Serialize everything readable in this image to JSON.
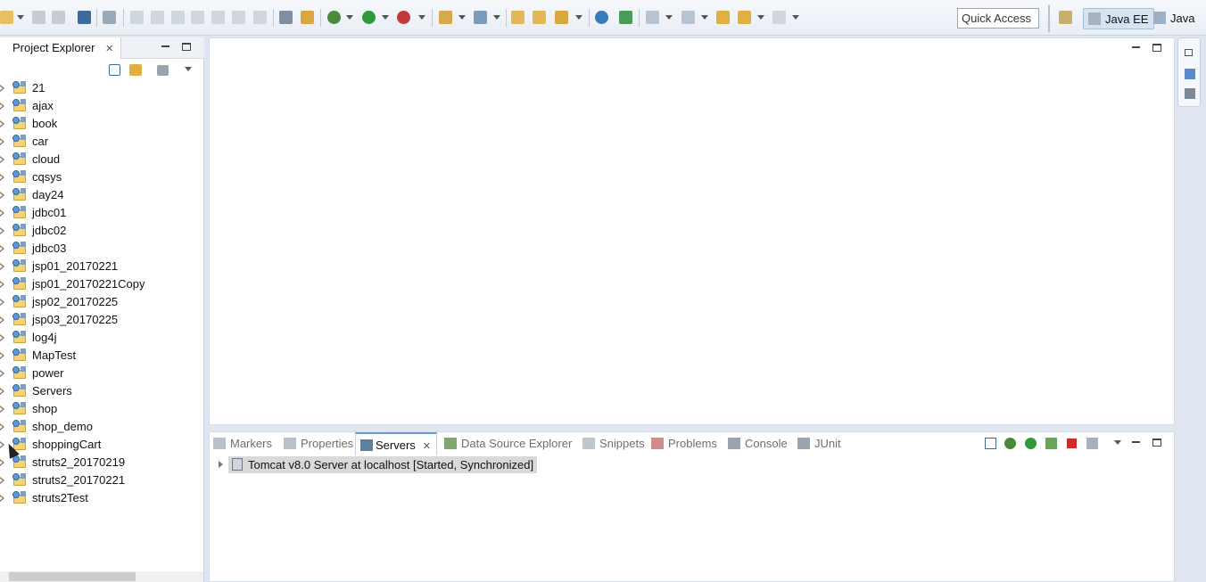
{
  "toolbar": {
    "quick_access_placeholder": "Quick Access",
    "icons": [
      "new-icon",
      "save-icon",
      "save-all-icon",
      "print-icon",
      "skip-breakpoints-icon",
      "resume-icon",
      "suspend-icon",
      "terminate-icon",
      "disconnect-icon",
      "step-into-icon",
      "step-over-icon",
      "step-return-icon",
      "drop-to-frame-icon",
      "use-step-filters-icon",
      "debug-icon",
      "run-icon",
      "external-tools-icon",
      "new-server-icon",
      "new-java-project-icon",
      "open-type-icon",
      "open-task-icon",
      "search-icon",
      "web-browser-icon",
      "run-server-icon",
      "next-annotation-icon",
      "prev-annotation-icon",
      "last-edit-icon",
      "back-icon",
      "forward-icon"
    ]
  },
  "perspectives": [
    {
      "label": "Java EE",
      "active": true
    },
    {
      "label": "Java",
      "active": false
    }
  ],
  "project_explorer": {
    "title": "Project Explorer",
    "close": "✕",
    "projects": [
      "21",
      "ajax",
      "book",
      "car",
      "cloud",
      "cqsys",
      "day24",
      "jdbc01",
      "jdbc02",
      "jdbc03",
      "jsp01_20170221",
      "jsp01_20170221Copy",
      "jsp02_20170225",
      "jsp03_20170225",
      "log4j",
      "MapTest",
      "power",
      "Servers",
      "shop",
      "shop_demo",
      "shoppingCart",
      "struts2_20170219",
      "struts2_20170221",
      "struts2Test"
    ]
  },
  "bottom_panel": {
    "tabs": [
      {
        "label": "Markers",
        "active": false
      },
      {
        "label": "Properties",
        "active": false
      },
      {
        "label": "Servers",
        "active": true
      },
      {
        "label": "Data Source Explorer",
        "active": false
      },
      {
        "label": "Snippets",
        "active": false
      },
      {
        "label": "Problems",
        "active": false
      },
      {
        "label": "Console",
        "active": false
      },
      {
        "label": "JUnit",
        "active": false
      }
    ],
    "close": "✕",
    "server_entry": "Tomcat v8.0 Server at localhost  [Started, Synchronized]"
  },
  "colors": {
    "accent": "#6a9ad0",
    "toolbar_bg": "#e9eef5",
    "selection": "#d9d9d9"
  }
}
